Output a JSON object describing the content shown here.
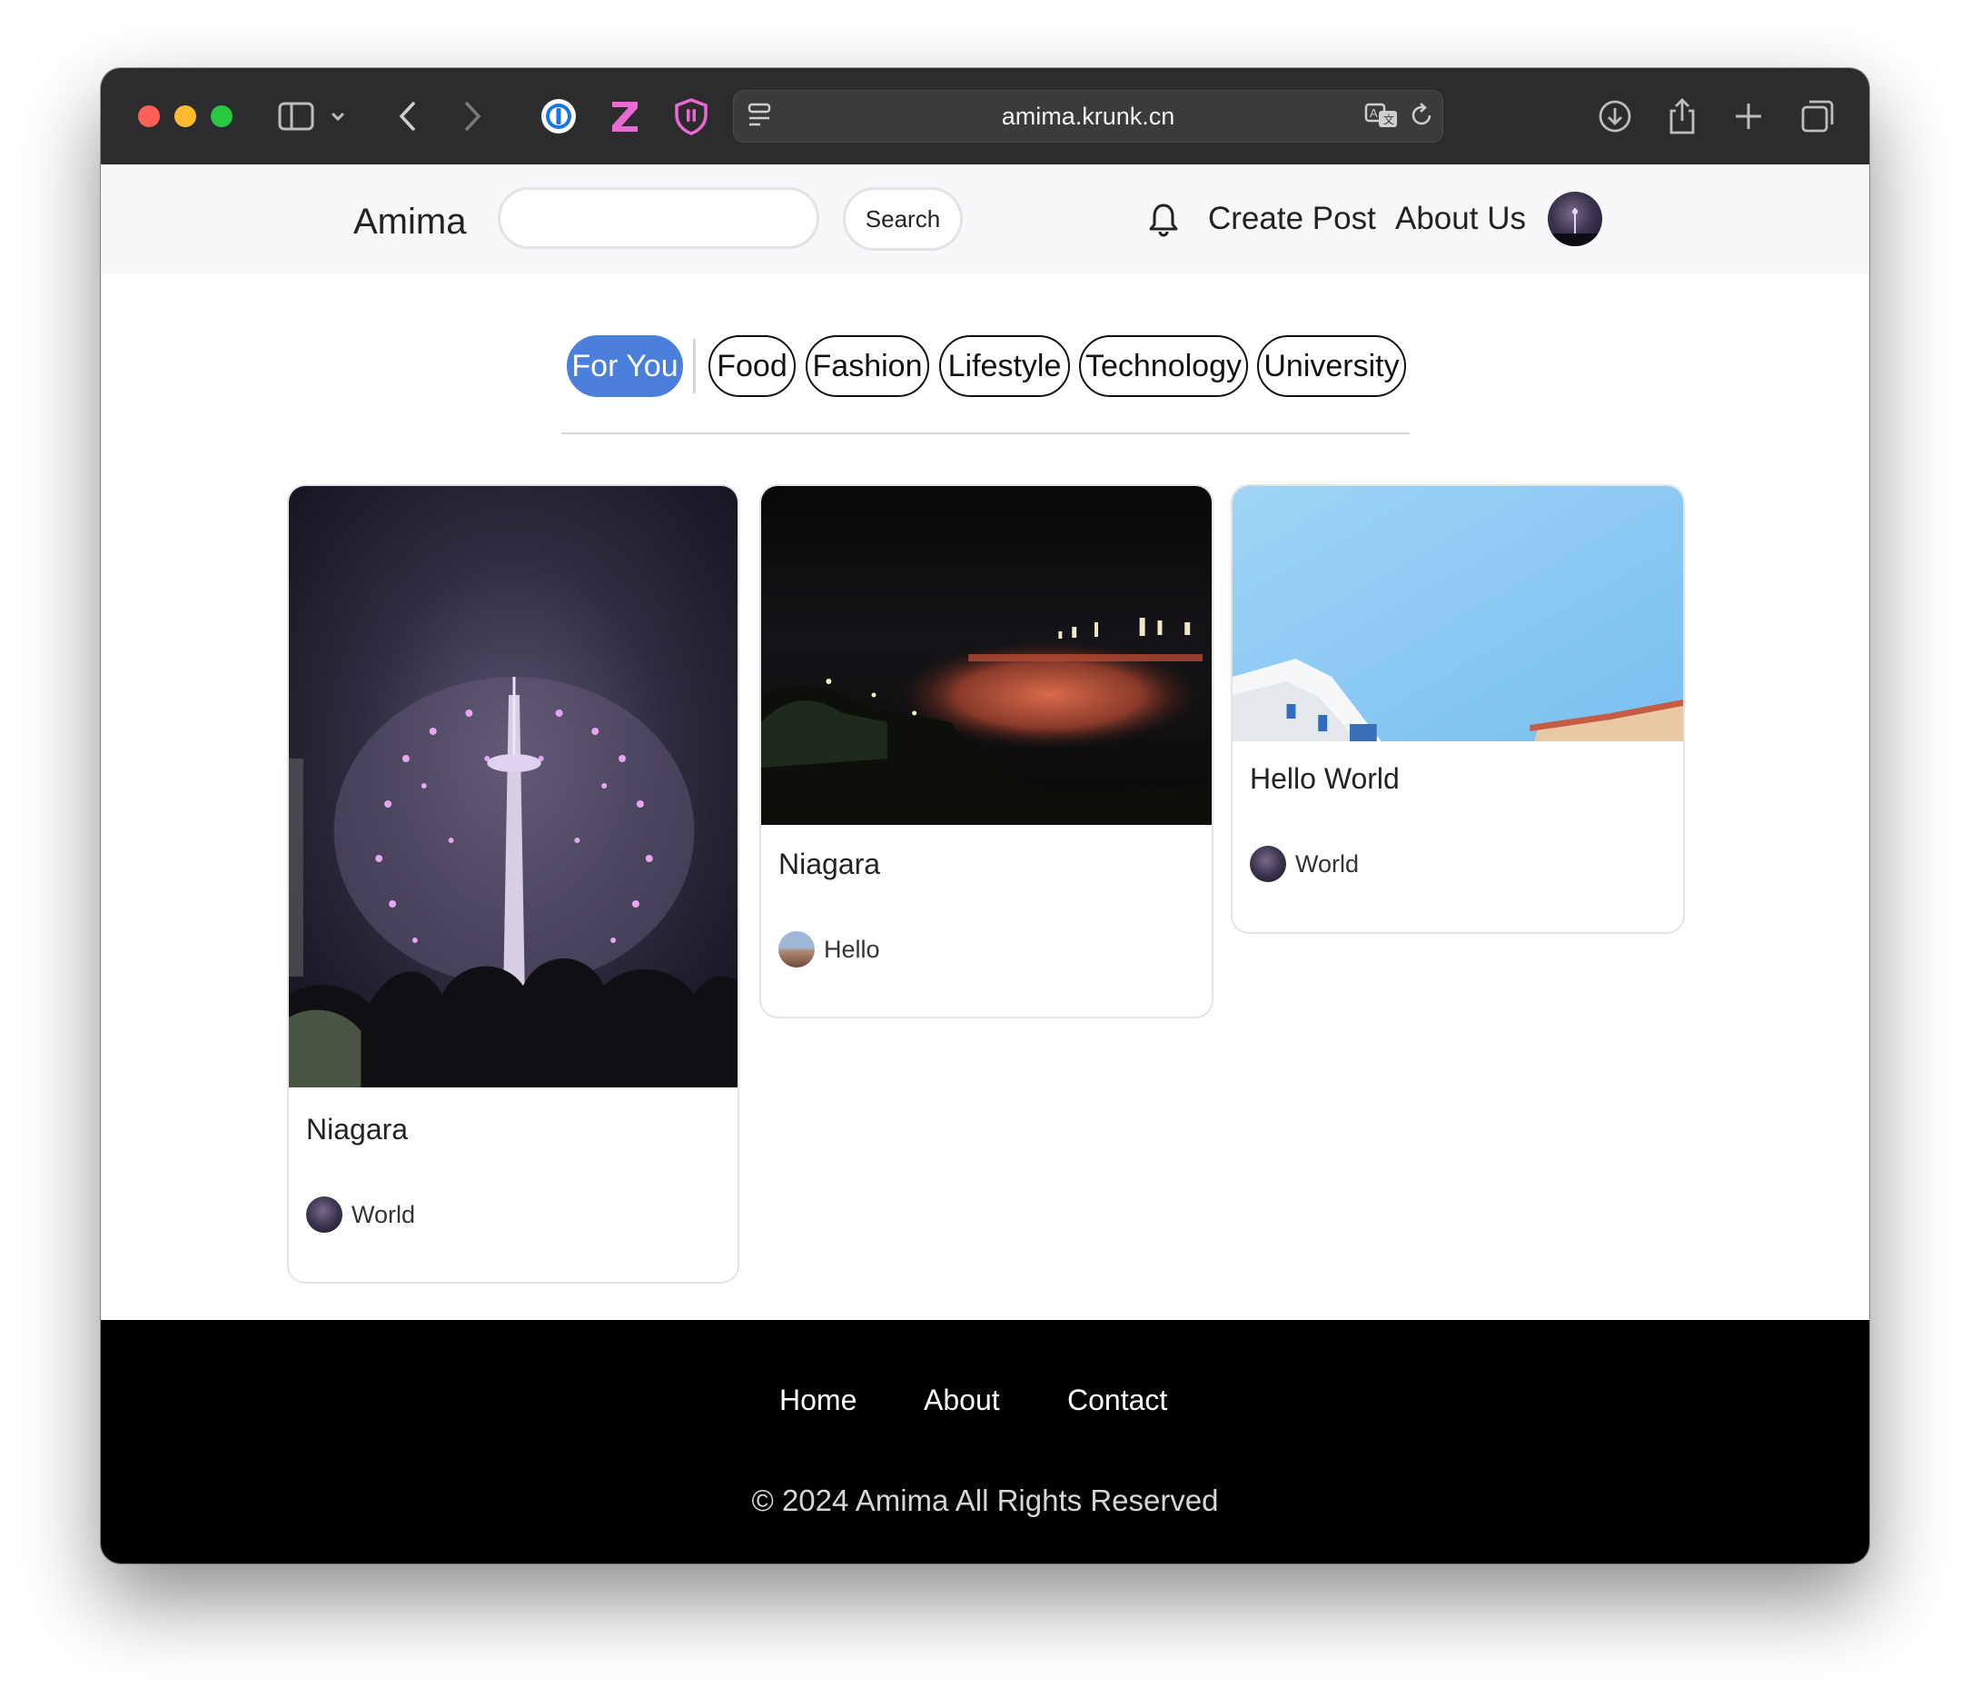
{
  "browser": {
    "url": "amima.krunk.cn"
  },
  "header": {
    "brand": "Amima",
    "search_value": "",
    "search_button": "Search",
    "nav": [
      "Create Post",
      "About Us"
    ]
  },
  "categories": [
    {
      "label": "For You",
      "active": true
    },
    {
      "label": "Food",
      "active": false
    },
    {
      "label": "Fashion",
      "active": false
    },
    {
      "label": "Lifestyle",
      "active": false
    },
    {
      "label": "Technology",
      "active": false
    },
    {
      "label": "University",
      "active": false
    }
  ],
  "posts": [
    {
      "title": "Niagara",
      "author": "World",
      "image": "fireworks-tower-photo"
    },
    {
      "title": "Niagara",
      "author": "Hello",
      "image": "night-falls-photo"
    },
    {
      "title": "Hello World",
      "author": "World",
      "image": "blue-sky-building-photo"
    }
  ],
  "footer": {
    "links": [
      "Home",
      "About",
      "Contact"
    ],
    "copyright": "© 2024 Amima All Rights Reserved"
  },
  "colors": {
    "accent": "#4a7fdc",
    "toolbar": "#2c2c2e",
    "header_bg": "#f6f7f9",
    "footer_bg": "#000000"
  }
}
